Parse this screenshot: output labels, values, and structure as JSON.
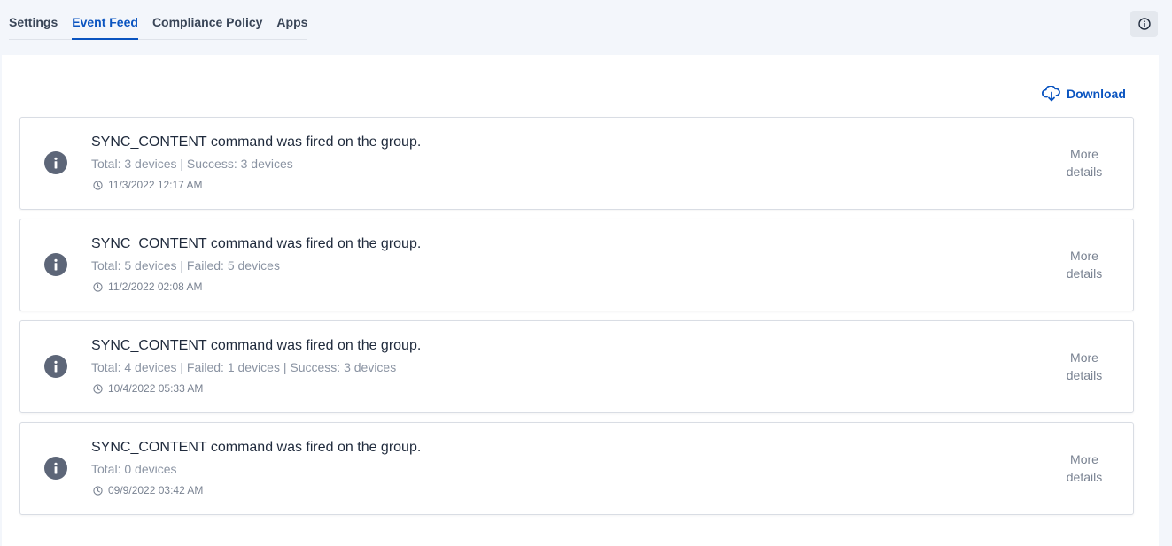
{
  "tabs": [
    {
      "label": "Settings",
      "active": false
    },
    {
      "label": "Event Feed",
      "active": true
    },
    {
      "label": "Compliance Policy",
      "active": false
    },
    {
      "label": "Apps",
      "active": false
    }
  ],
  "header": {
    "info_icon": "info-circle-icon"
  },
  "toolbar": {
    "download_label": "Download",
    "download_icon": "cloud-download-icon"
  },
  "events": [
    {
      "title": "SYNC_CONTENT command was fired on the group.",
      "summary": "Total: 3 devices | Success: 3 devices",
      "timestamp": "11/3/2022 12:17 AM",
      "more_label": "More details",
      "icon": "info-icon"
    },
    {
      "title": "SYNC_CONTENT command was fired on the group.",
      "summary": "Total: 5 devices | Failed: 5 devices",
      "timestamp": "11/2/2022 02:08 AM",
      "more_label": "More details",
      "icon": "info-icon"
    },
    {
      "title": "SYNC_CONTENT command was fired on the group.",
      "summary": "Total: 4 devices | Failed: 1 devices | Success: 3 devices",
      "timestamp": "10/4/2022 05:33 AM",
      "more_label": "More details",
      "icon": "info-icon"
    },
    {
      "title": "SYNC_CONTENT command was fired on the group.",
      "summary": "Total: 0 devices",
      "timestamp": "09/9/2022 03:42 AM",
      "more_label": "More details",
      "icon": "info-icon"
    }
  ],
  "colors": {
    "accent": "#0a54c0",
    "page_background": "#f3f6fb",
    "event_icon": "#5d6678",
    "muted_text": "#8b94a3"
  }
}
